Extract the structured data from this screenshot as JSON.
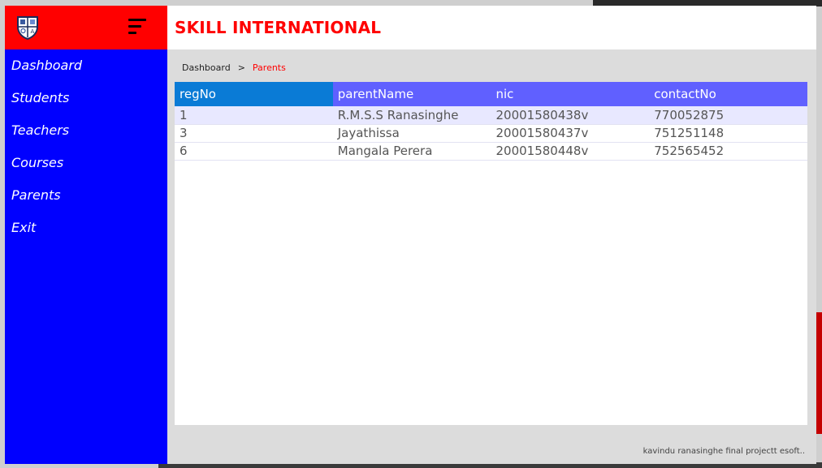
{
  "sidebar": {
    "menu_icon": "hamburger-menu-icon",
    "logo_icon": "school-crest-logo",
    "items": [
      {
        "label": "Dashboard"
      },
      {
        "label": "Students"
      },
      {
        "label": "Teachers"
      },
      {
        "label": "Courses"
      },
      {
        "label": "Parents"
      },
      {
        "label": "Exit"
      }
    ]
  },
  "header": {
    "title": "SKILL INTERNATIONAL"
  },
  "breadcrumb": {
    "root": "Dashboard",
    "separator": ">",
    "current": "Parents"
  },
  "table": {
    "columns": [
      "regNo",
      "parentName",
      "nic",
      "contactNo"
    ],
    "rows": [
      {
        "regNo": "1",
        "parentName": "R.M.S.S Ranasinghe",
        "nic": "20001580438v",
        "contactNo": "770052875"
      },
      {
        "regNo": "3",
        "parentName": "Jayathissa",
        "nic": "20001580437v",
        "contactNo": "751251148"
      },
      {
        "regNo": "6",
        "parentName": "Mangala Perera",
        "nic": "20001580448v",
        "contactNo": "752565452"
      }
    ]
  },
  "footer": {
    "text": "kavindu ranasinghe final projectt esoft.."
  },
  "colors": {
    "sidebar": "#0000ff",
    "logo_bar": "#ff0000",
    "title": "#ff0000",
    "table_header": "#6060ff",
    "sorted_header": "#0a7bd6"
  }
}
